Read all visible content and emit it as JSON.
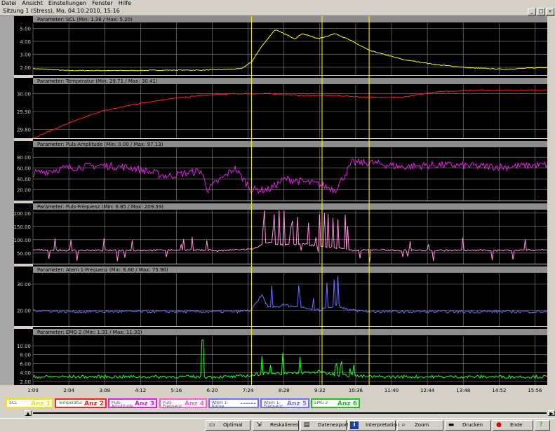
{
  "menu": [
    "Datei",
    "Ansicht",
    "Einstellungen",
    "Fenster",
    "Hilfe"
  ],
  "window": {
    "title": "Sitzung 1 (Stress), Mo, 04.10.2010, 15:16",
    "btn_min": "_",
    "btn_max": "□",
    "btn_close": "×"
  },
  "colors": {
    "SCL": "#ffff00",
    "Temperatur": "#ff2020",
    "Puls-Amplitude": "#e020e0",
    "Puls-Frequenz": "#ff90e0",
    "Atem 1-Frequenz": "#7070ff",
    "EMG 2": "#20ff20",
    "marker": "#ffff00",
    "grid": "#8a8a8a",
    "plot_bg": "#000000"
  },
  "chart_data": {
    "type": "line",
    "x_ticks": [
      "1:00",
      "2:04",
      "3:08",
      "4:12",
      "5:16",
      "6:20",
      "7:24",
      "8:28",
      "9:32",
      "10:36",
      "11:40",
      "12:44",
      "13:48",
      "14:52",
      "15:56"
    ],
    "markers_min": [
      7.5,
      9.6,
      11.0
    ],
    "panels": [
      {
        "name": "SCL",
        "title": "Parameter: SCL (Min: 1.36 / Max: 5.20)",
        "yticks": [
          2.0,
          3.0,
          4.0,
          5.0
        ],
        "ylim": [
          1.4,
          5.4
        ],
        "x": [
          1.0,
          2.0,
          3.0,
          4.0,
          5.0,
          6.0,
          7.0,
          7.2,
          7.5,
          7.8,
          8.2,
          8.8,
          9.0,
          9.5,
          10.0,
          10.5,
          11.0,
          12.0,
          13.0,
          14.0,
          15.0,
          16.3
        ],
        "y": [
          1.9,
          1.75,
          1.75,
          1.75,
          1.78,
          1.78,
          1.85,
          1.9,
          2.4,
          3.6,
          4.9,
          4.2,
          4.6,
          4.2,
          4.6,
          4.0,
          3.3,
          2.6,
          2.2,
          1.95,
          1.85,
          2.0
        ]
      },
      {
        "name": "Temperatur",
        "title": "Parameter: Temperatur (Min: 29.71 / Max: 30.41)",
        "yticks": [
          29.8,
          29.9,
          30.0
        ],
        "ylim": [
          29.75,
          30.05
        ],
        "x": [
          1.0,
          2.0,
          3.0,
          4.0,
          5.0,
          6.0,
          7.0,
          8.0,
          9.0,
          10.0,
          11.0,
          12.0,
          13.0,
          14.0,
          15.0,
          16.3
        ],
        "y": [
          29.75,
          29.83,
          29.9,
          29.94,
          29.97,
          29.99,
          30.0,
          30.0,
          29.99,
          29.99,
          29.98,
          29.98,
          30.01,
          30.02,
          30.02,
          30.02
        ]
      },
      {
        "name": "Puls-Amplitude",
        "title": "Parameter: Puls-Amplitude (Min: 0.00 / Max: 97.13)",
        "yticks": [
          20.0,
          40.0,
          60.0,
          80.0
        ],
        "ylim": [
          0,
          97
        ],
        "x": [
          1.0,
          2.0,
          3.0,
          4.0,
          5.0,
          6.0,
          6.2,
          6.5,
          7.0,
          7.5,
          8.0,
          8.5,
          9.0,
          9.5,
          10.0,
          10.5,
          11.0,
          12.0,
          13.0,
          14.0,
          15.0,
          16.3
        ],
        "y": [
          50,
          60,
          65,
          60,
          45,
          55,
          20,
          35,
          60,
          20,
          20,
          40,
          35,
          30,
          20,
          70,
          70,
          62,
          66,
          64,
          62,
          66
        ]
      },
      {
        "name": "Puls-Frequenz",
        "title": "Parameter: Puls-Frequenz (Min: 6.85 / Max: 209.59)",
        "yticks": [
          50.0,
          100.0,
          150.0,
          200.0
        ],
        "ylim": [
          10,
          210
        ],
        "x": [
          1.0,
          2.0,
          3.0,
          4.0,
          5.0,
          6.0,
          6.2,
          6.5,
          7.0,
          7.5,
          8.0,
          8.5,
          9.0,
          9.5,
          10.0,
          10.5,
          11.0,
          12.0,
          13.0,
          14.0,
          15.0,
          16.3
        ],
        "y": [
          62,
          60,
          60,
          60,
          61,
          61,
          62,
          58,
          62,
          64,
          90,
          80,
          85,
          75,
          70,
          60,
          62,
          60,
          60,
          60,
          60,
          62
        ]
      },
      {
        "name": "Atem 1-Frequenz",
        "title": "Parameter: Atem 1-Frequenz (Min: 6.80 / Max: 75.96)",
        "yticks": [
          20.0,
          30.0
        ],
        "ylim": [
          14,
          34
        ],
        "x": [
          1.0,
          2.0,
          3.0,
          4.0,
          5.0,
          6.0,
          7.0,
          7.5,
          7.8,
          8.0,
          8.5,
          9.0,
          9.5,
          10.0,
          10.5,
          11.0,
          12.0,
          13.0,
          14.0,
          15.0,
          16.3
        ],
        "y": [
          20,
          19.5,
          19.5,
          19.5,
          19.5,
          19.5,
          19.5,
          20,
          26,
          21,
          22,
          21,
          20,
          22,
          20,
          19.5,
          19.5,
          19.5,
          19.5,
          19.5,
          19.5
        ]
      },
      {
        "name": "EMG 2",
        "title": "Parameter: EMG 2 (Min: 1.31 / Max: 11.32)",
        "yticks": [
          2.0,
          4.0,
          6.0,
          8.0,
          10.0
        ],
        "ylim": [
          1.2,
          12.2
        ],
        "x": [
          1.0,
          2.0,
          3.0,
          4.0,
          5.0,
          6.0,
          7.0,
          7.5,
          8.0,
          8.5,
          9.0,
          9.5,
          10.0,
          10.5,
          11.0,
          12.0,
          13.0,
          14.0,
          15.0,
          16.3
        ],
        "y": [
          2.7,
          2.7,
          2.7,
          2.7,
          2.7,
          2.7,
          2.7,
          3.0,
          3.6,
          3.4,
          3.6,
          3.8,
          3.2,
          2.9,
          2.7,
          2.7,
          2.7,
          2.7,
          2.7,
          2.7
        ]
      }
    ]
  },
  "legend": [
    {
      "label": "SCL",
      "anz": "Anz 1",
      "color": "#e8e800"
    },
    {
      "label": "Temperatur",
      "anz": "Anz 2",
      "color": "#ff2020"
    },
    {
      "label": "Puls-Amplitude",
      "anz": "Anz 3",
      "color": "#e020e0"
    },
    {
      "label": "Puls-Frequenz",
      "anz": "Anz 4",
      "color": "#ff60d0"
    },
    {
      "label": "Atem 1-Kurve",
      "anz": "------",
      "color": "#7070ff"
    },
    {
      "label": "Atem 1-Frequenz",
      "anz": "Anz 5",
      "color": "#7070ff"
    },
    {
      "label": "EMG 2",
      "anz": "Anz 6",
      "color": "#20c020"
    }
  ],
  "toolbar": [
    {
      "label": "Optimal",
      "icon": "auto-fit-icon",
      "glyph": "▭"
    },
    {
      "label": "Reskalieren",
      "icon": "rescale-icon",
      "glyph": "⇲"
    },
    {
      "label": "Datenexport",
      "icon": "export-icon",
      "glyph": "▤"
    },
    {
      "label": "Interpretation",
      "icon": "info-icon",
      "glyph": "i"
    },
    {
      "label": "Zoom",
      "icon": "magnifier-icon",
      "glyph": "⌕"
    },
    {
      "label": "Drucken",
      "icon": "printer-icon",
      "glyph": "▬"
    },
    {
      "label": "Ende",
      "icon": "stop-icon",
      "glyph": "●"
    },
    {
      "label": "",
      "icon": "help-icon",
      "glyph": "?"
    }
  ]
}
